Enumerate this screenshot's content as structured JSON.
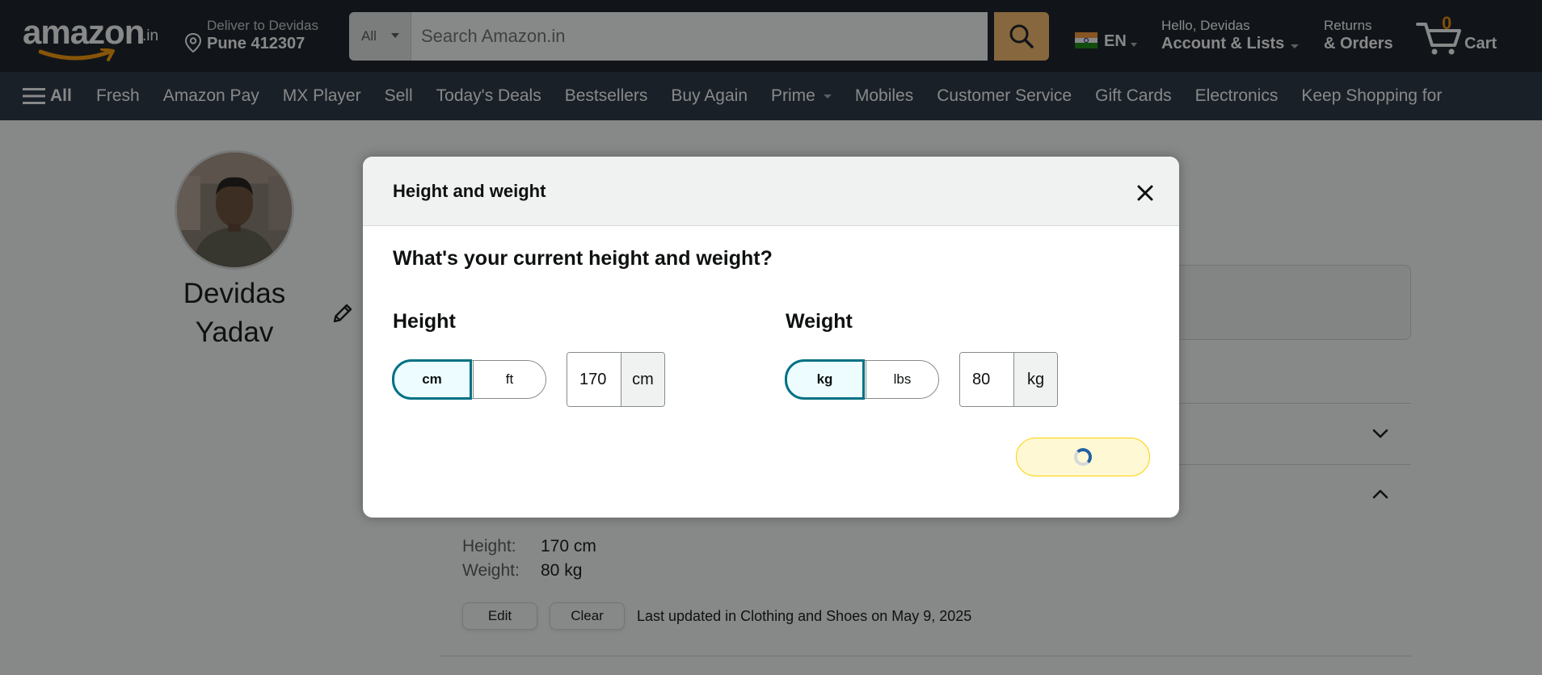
{
  "header": {
    "logo_text": "amazon",
    "logo_suffix": ".in",
    "deliver_line1": "Deliver to Devidas",
    "deliver_line2": "Pune 412307",
    "search_category": "All",
    "search_placeholder": "Search Amazon.in",
    "language": "EN",
    "account_line1": "Hello, Devidas",
    "account_line2": "Account & Lists",
    "orders_line1": "Returns",
    "orders_line2": "& Orders",
    "cart_count": "0",
    "cart_label": "Cart"
  },
  "nav": {
    "all_label": "All",
    "links": [
      "Fresh",
      "Amazon Pay",
      "MX Player",
      "Sell",
      "Today's Deals",
      "Bestsellers",
      "Buy Again",
      "Prime",
      "Mobiles",
      "Customer Service",
      "Gift Cards",
      "Electronics",
      "Keep Shopping for"
    ]
  },
  "profile": {
    "name_line1": "Devidas",
    "name_line2": "Yadav"
  },
  "details": {
    "height_key": "Height:",
    "height_value": "170 cm",
    "weight_key": "Weight:",
    "weight_value": "80 kg",
    "edit_label": "Edit",
    "clear_label": "Clear",
    "updated_text": "Last updated in Clothing and Shoes on May 9, 2025"
  },
  "modal": {
    "title": "Height and weight",
    "question": "What's your current height and weight?",
    "height": {
      "label": "Height",
      "unit_selected": "cm",
      "unit_other": "ft",
      "value": "170",
      "suffix": "cm"
    },
    "weight": {
      "label": "Weight",
      "unit_selected": "kg",
      "unit_other": "lbs",
      "value": "80",
      "suffix": "kg"
    },
    "save_state": "loading"
  },
  "colors": {
    "nav_dark": "#131921",
    "nav_secondary": "#232f3e",
    "search_button": "#febd69",
    "selected_toggle_border": "#007185",
    "selected_toggle_bg": "#edfdff",
    "save_button_bg": "#fff8d5",
    "cart_count": "#f08804"
  }
}
